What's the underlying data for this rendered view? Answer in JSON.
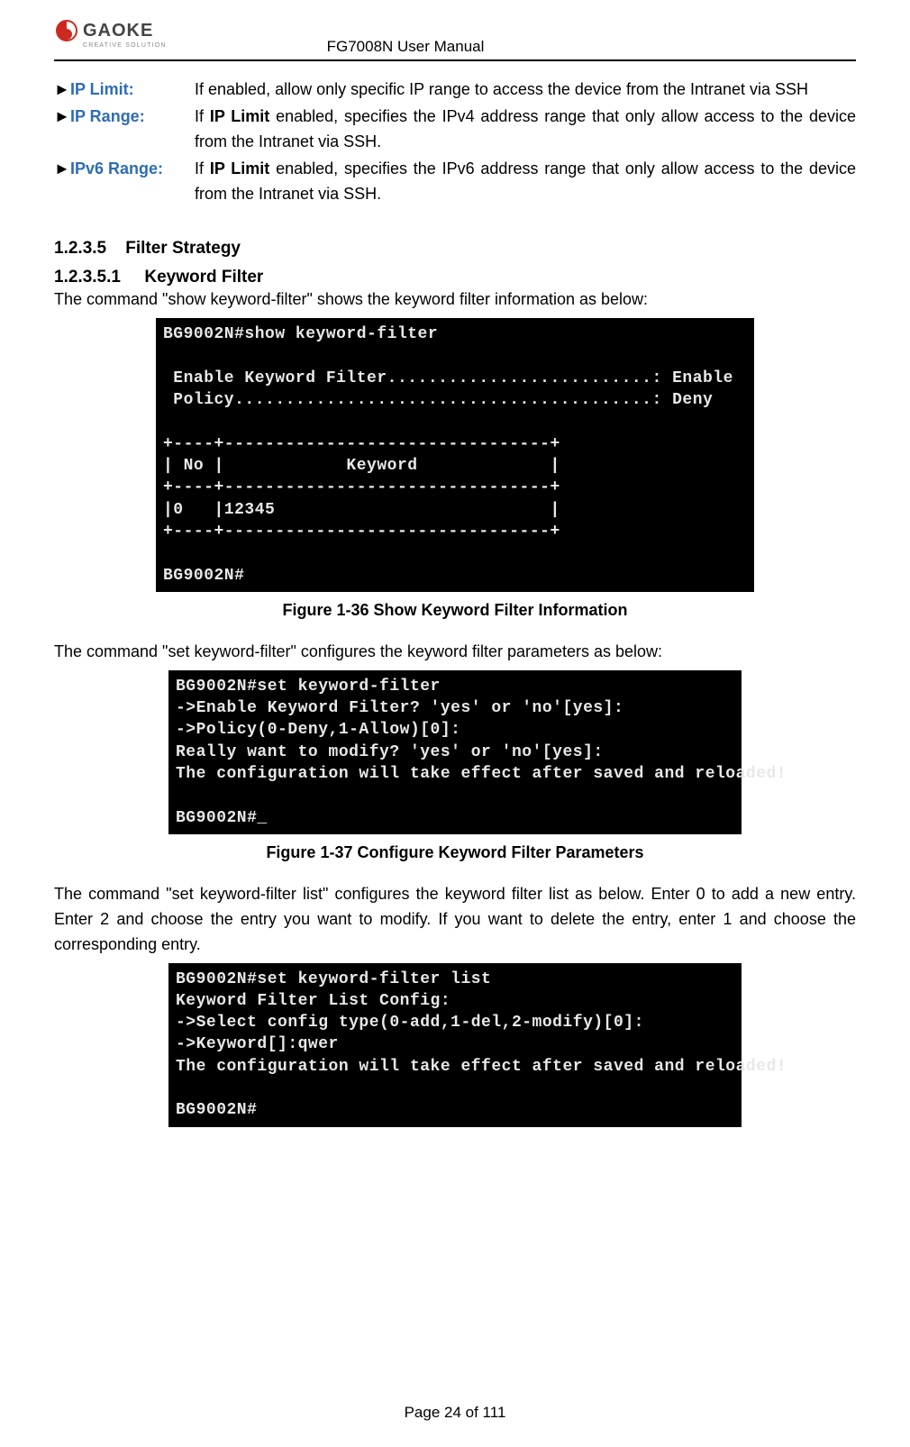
{
  "header": {
    "doc_title": "FG7008N User Manual",
    "logo_main": "GAOKE",
    "logo_sub": "CREATIVE SOLUTION"
  },
  "bullets": {
    "arrow": "►",
    "ip_limit": {
      "label": "IP Limit:",
      "desc": "If enabled, allow only specific IP range to access the device from the Intranet via SSH"
    },
    "ip_range": {
      "label": "IP Range:",
      "desc_prefix": "If ",
      "desc_bold": "IP Limit",
      "desc_suffix": " enabled, specifies the IPv4 address range that only allow access to the device from the Intranet via SSH."
    },
    "ipv6_range": {
      "label": "IPv6 Range:",
      "desc_prefix": "If ",
      "desc_bold": "IP Limit",
      "desc_suffix": " enabled, specifies the IPv6 address range that only allow access to the device from the Intranet via SSH."
    }
  },
  "sections": {
    "filter_strategy_num": "1.2.3.5",
    "filter_strategy_title": "Filter Strategy",
    "keyword_filter_num": "1.2.3.5.1",
    "keyword_filter_title": "Keyword Filter"
  },
  "paragraphs": {
    "p1": "The command \"show keyword-filter\" shows the keyword filter information as below:",
    "p2": "The command \"set keyword-filter\" configures the keyword filter parameters as below:",
    "p3": "The command \"set keyword-filter list\" configures the keyword filter list as below. Enter 0 to add a new entry. Enter 2 and choose the entry you want to modify. If you want to delete the entry, enter 1 and choose the corresponding entry."
  },
  "figures": {
    "fig1": "Figure 1-36    Show Keyword Filter Information",
    "fig2": "Figure 1-37    Configure Keyword Filter Parameters"
  },
  "terminals": {
    "t1": "BG9002N#show keyword-filter\n\n Enable Keyword Filter..........................: Enable\n Policy.........................................: Deny\n\n+----+--------------------------------+\n| No |            Keyword             |\n+----+--------------------------------+\n|0   |12345                           |\n+----+--------------------------------+\n\nBG9002N#",
    "t2": "BG9002N#set keyword-filter\n->Enable Keyword Filter? 'yes' or 'no'[yes]:\n->Policy(0-Deny,1-Allow)[0]:\nReally want to modify? 'yes' or 'no'[yes]:\nThe configuration will take effect after saved and reloaded!\n\nBG9002N#_",
    "t3": "BG9002N#set keyword-filter list\nKeyword Filter List Config:\n->Select config type(0-add,1-del,2-modify)[0]:\n->Keyword[]:qwer\nThe configuration will take effect after saved and reloaded!\n\nBG9002N#"
  },
  "pager": "Page 24 of 111"
}
